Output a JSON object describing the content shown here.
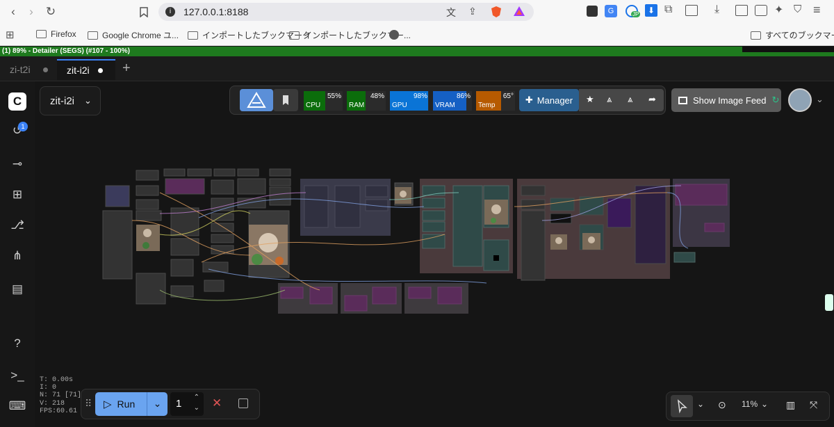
{
  "browser": {
    "url": "127.0.0.1:8188",
    "bookmarks": [
      "Firefox",
      "Google Chrome ユ...",
      "インポートしたブックマーク",
      "インポートしたブックマー...",
      "すべてのブックマーク"
    ],
    "ext_badge": "JP"
  },
  "progress": {
    "text": "(1) 89% - Detailer (SEGS) (#107 - 100%)",
    "value": 0.89
  },
  "tabs": [
    {
      "label": "zi-t2i",
      "active": false
    },
    {
      "label": "zit-i2i",
      "active": true
    }
  ],
  "sidebar": {
    "queue_badge": "1"
  },
  "workflow": {
    "name": "zit-i2i"
  },
  "monitor": [
    {
      "label": "CPU",
      "value": "55%",
      "level": 0.55,
      "color": "#0b6d0b"
    },
    {
      "label": "RAM",
      "value": "48%",
      "level": 0.48,
      "color": "#0b6d0b"
    },
    {
      "label": "GPU",
      "value": "98%",
      "level": 0.98,
      "color": "#0a74d6"
    },
    {
      "label": "VRAM",
      "value": "86%",
      "level": 0.86,
      "color": "#1560c4"
    },
    {
      "label": "Temp",
      "value": "65°",
      "level": 0.65,
      "color": "#b65a00"
    }
  ],
  "manager": {
    "label": "Manager"
  },
  "feed": {
    "label": "Show Image Feed"
  },
  "run": {
    "label": "Run",
    "count": "1"
  },
  "stats": [
    "T: 0.00s",
    "I: 0",
    "N: 71 [71]",
    "V: 218",
    "FPS:60.61"
  ],
  "zoom": {
    "value": "11%"
  }
}
